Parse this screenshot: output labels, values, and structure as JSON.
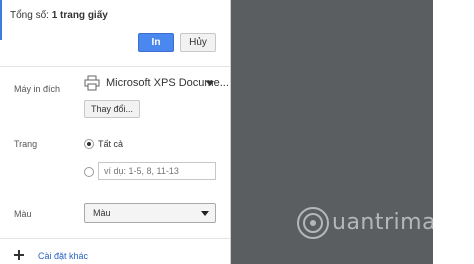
{
  "summary": {
    "label": "Tổng số:",
    "value": "1 trang giấy"
  },
  "actions": {
    "print_label": "In",
    "cancel_label": "Hủy"
  },
  "destination": {
    "label": "Máy in đích",
    "printer_name": "Microsoft XPS Docume...",
    "change_label": "Thay đổi..."
  },
  "pages": {
    "label": "Trang",
    "option_all": "Tất cả",
    "range_placeholder": "ví dụ: 1-5, 8, 11-13",
    "selected": "all"
  },
  "color": {
    "label": "Màu",
    "selected": "Màu"
  },
  "more_settings": {
    "label": "Cài đặt khác"
  },
  "watermark": {
    "text": "uantrimang"
  },
  "colors": {
    "accent": "#4a87ee",
    "preview_bg": "#5b5e61",
    "link": "#2a64c7"
  }
}
